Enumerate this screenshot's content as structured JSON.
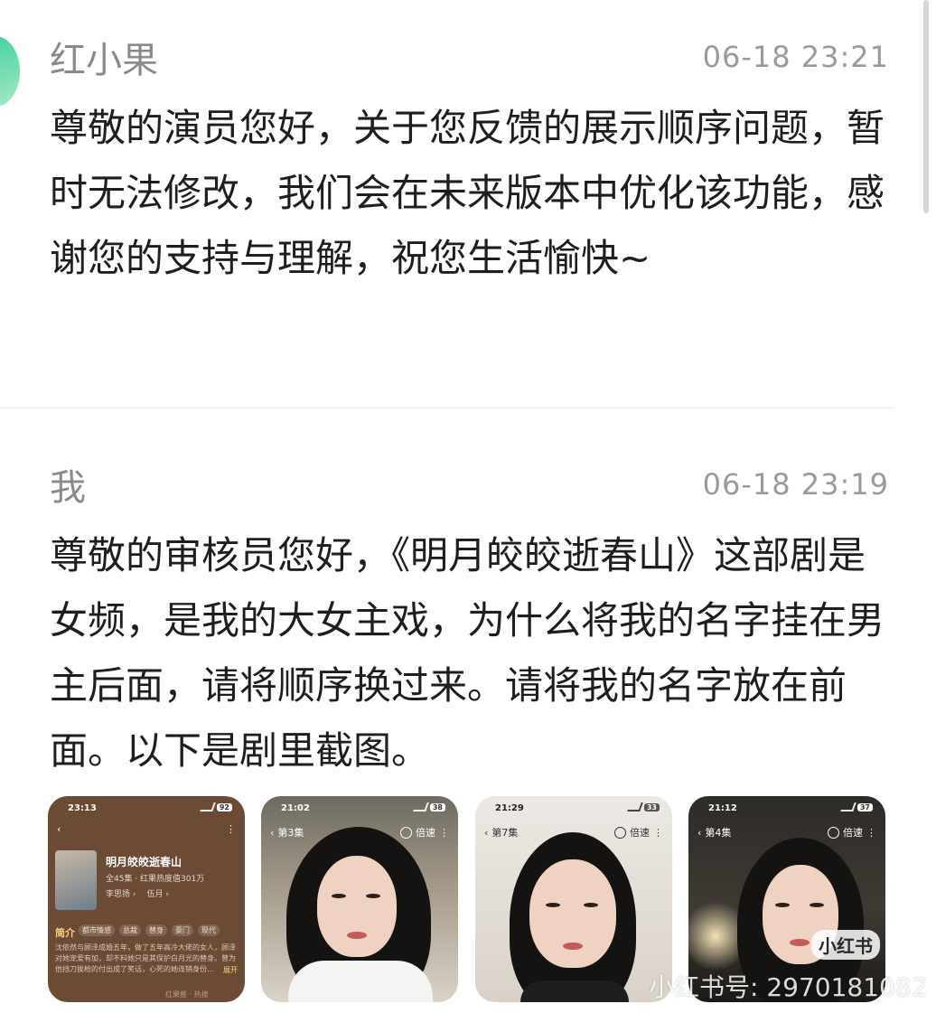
{
  "messages": [
    {
      "sender": "红小果",
      "time": "06-18 23:21",
      "text": "尊敬的演员您好，关于您反馈的展示顺序问题，暂时无法修改，我们会在未来版本中优化该功能，感谢您的支持与理解，祝您生活愉快~"
    },
    {
      "sender": "我",
      "time": "06-18 23:19",
      "text": "尊敬的审核员您好，《明月皎皎逝春山》这部剧是女频，是我的大女主戏，为什么将我的名字挂在男主后面，请将顺序换过来。请将我的名字放在前面。以下是剧里截图。"
    }
  ],
  "screenshots": [
    {
      "status_time": "23:13",
      "battery": "92",
      "title": "明月皎皎逝春山",
      "meta": "全45集 · 红果热度值301万",
      "actors": [
        "李思扬 ›",
        "伍月 ›"
      ],
      "intro_label": "简介",
      "tags": [
        "都市情感",
        "总裁",
        "替身",
        "豪门",
        "现代"
      ],
      "desc": "沈依然与顾泽成婚五年，做了五年高冷大佬的女人，顾泽对她宠爱有加，却不料她只是其保护白月光的替身。曾为他挡刀挨枪的付出成了笑话，心死的她连销身份…",
      "expand": "展开",
      "bottom": "红果推 · 热搜"
    },
    {
      "status_time": "21:02",
      "battery": "38",
      "episode": "第3集",
      "speed": "倍速"
    },
    {
      "status_time": "21:29",
      "battery": "33",
      "episode": "第7集",
      "speed": "倍速"
    },
    {
      "status_time": "21:12",
      "battery": "37",
      "episode": "第4集",
      "speed": "倍速",
      "logo": "小红书"
    }
  ],
  "watermark": "小红书号: 2970181082"
}
